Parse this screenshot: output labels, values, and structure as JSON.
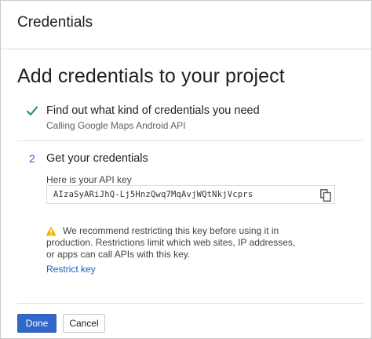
{
  "header": {
    "title": "Credentials"
  },
  "page": {
    "title": "Add credentials to your project"
  },
  "step1": {
    "title": "Find out what kind of credentials you need",
    "subtitle": "Calling Google Maps Android API"
  },
  "step2": {
    "number": "2",
    "title": "Get your credentials",
    "key_label": "Here is your API key",
    "key_value": "AIzaSyARiJhQ-Lj5HnzQwq7MqAvjWQtNkjVcprs"
  },
  "warning": {
    "text": "We recommend restricting this key before using it in production. Restrictions limit which web sites, IP addresses, or apps can call APIs with this key.",
    "link": "Restrict key"
  },
  "footer": {
    "done_label": "Done",
    "cancel_label": "Cancel"
  },
  "colors": {
    "accent": "#3067c9",
    "check": "#2e9e4f",
    "warning": "#f2b400"
  },
  "icons": {
    "step1": "check-icon",
    "copy": "copy-icon",
    "warning": "warning-icon"
  }
}
